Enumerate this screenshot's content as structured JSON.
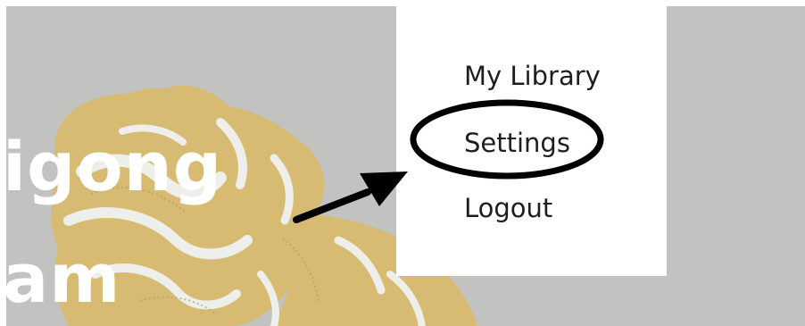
{
  "hero": {
    "title_line_1": "igong",
    "title_line_2": "am"
  },
  "menu": {
    "items": [
      {
        "label": "My Library"
      },
      {
        "label": "Settings"
      },
      {
        "label": "Logout"
      }
    ]
  },
  "colors": {
    "hero_background": "#c2c2c0",
    "hero_art": "#d8bb72",
    "hero_title": "#ffffff",
    "menu_background": "#ffffff",
    "menu_text": "#1e1e1e",
    "annotation": "#000000"
  },
  "annotation": {
    "highlighted_item": "Settings",
    "marker": "circle-with-arrow"
  }
}
